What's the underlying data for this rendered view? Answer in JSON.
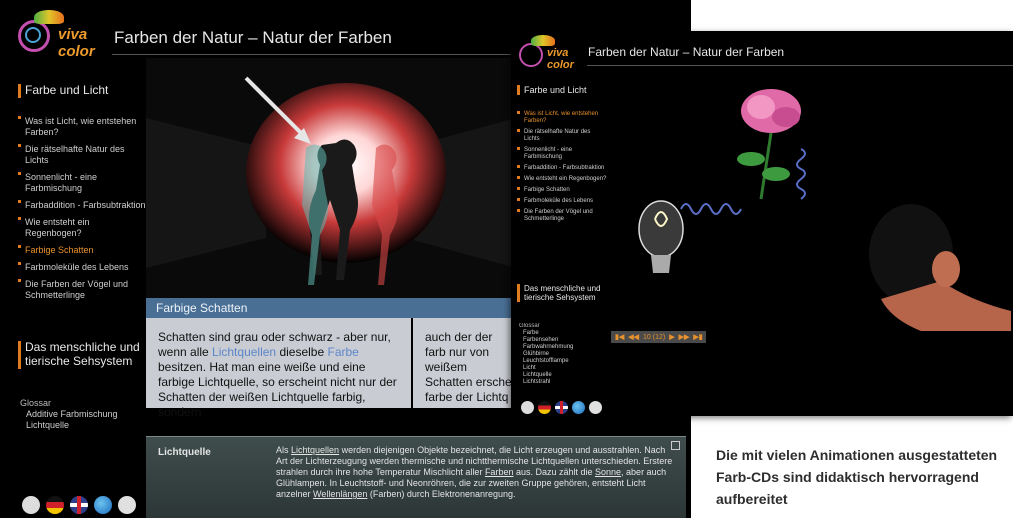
{
  "main_window": {
    "logo_text": "viva color",
    "title": "Farben der Natur – Natur der Farben",
    "section1": "Farbe und Licht",
    "nav": [
      "Was ist Licht, wie entstehen Farben?",
      "Die rätselhafte Natur des Lichts",
      "Sonnenlicht - eine Farbmischung",
      "Farbaddition - Farbsubtraktion",
      "Wie entsteht ein Regenbogen?",
      "Farbige Schatten",
      "Farbmoleküle des Lebens",
      "Die Farben der Vögel und Schmetterlinge"
    ],
    "nav_active_index": 5,
    "section2": "Das menschliche und tierische Sehsystem",
    "glossary": {
      "title": "Glossar",
      "items": [
        "Additive Farbmischung",
        "Lichtquelle"
      ]
    },
    "topic_title": "Farbige Schatten",
    "text_col1": {
      "p1": "Schatten sind grau oder schwarz - aber nur, wenn alle ",
      "link1": "Lichtquellen",
      "p2": " dieselbe ",
      "link2": "Farbe",
      "p3": " besitzen. Hat man eine weiße und eine farbige Lichtquelle, so erscheint nicht nur der Schatten der weißen Lichtquelle farbig, sondern"
    },
    "text_col2": "auch der der farb nur von weißem Schatten ersche farbe der Lichtq",
    "glossary_panel": {
      "term": "Lichtquelle",
      "s1": "Als ",
      "link1": "Lichtquellen",
      "s2": " werden diejenigen Objekte bezeichnet, die Licht erzeugen und ausstrahlen. Nach Art der Lichterzeugung werden thermische und nichtthermische Lichtquellen unterschieden. Erstere strahlen durch ihre hohe Temperatur Mischlicht aller ",
      "link2": "Farben",
      "s3": " aus. Dazu zählt die ",
      "link3": "Sonne",
      "s4": ", aber auch Glühlampen. In Leuchtstoff- und Neonröhren, die zur zweiten Gruppe gehören, entsteht Licht anzelner ",
      "link4": "Wellenlängen",
      "s5": " (Farben) durch Elektronenanregung."
    }
  },
  "second_window": {
    "logo_text": "viva color",
    "title": "Farben der Natur – Natur der Farben",
    "section1": "Farbe und Licht",
    "nav": [
      "Was ist Licht, wie entstehen Farben?",
      "Die rätselhafte Natur des Lichts",
      "Sonnenlicht - eine Farbmischung",
      "Farbaddition - Farbsubtraktion",
      "Wie entsteht ein Regenbogen?",
      "Farbige Schatten",
      "Farbmoleküle des Lebens",
      "Die Farben der Vögel und Schmetterlinge"
    ],
    "nav_active_index": 0,
    "section2": "Das menschliche und tierische Sehsystem",
    "glossary": {
      "title": "Glossar",
      "items": [
        "Farbe",
        "Farbensehen",
        "Farbwahrnehmung",
        "Glühbirne",
        "Leuchtstofflampe",
        "Licht",
        "Lichtquelle",
        "Lichtstrahl"
      ]
    },
    "player": {
      "counter": "10 (12)"
    }
  },
  "caption": "Die mit vielen Animationen ausgestatteten Farb-CDs sind didaktisch hervorragend aufbereitet",
  "colors": {
    "accent_orange": "#e07b20",
    "topic_bar": "#4a6f95",
    "link_blue": "#5c86c9"
  }
}
